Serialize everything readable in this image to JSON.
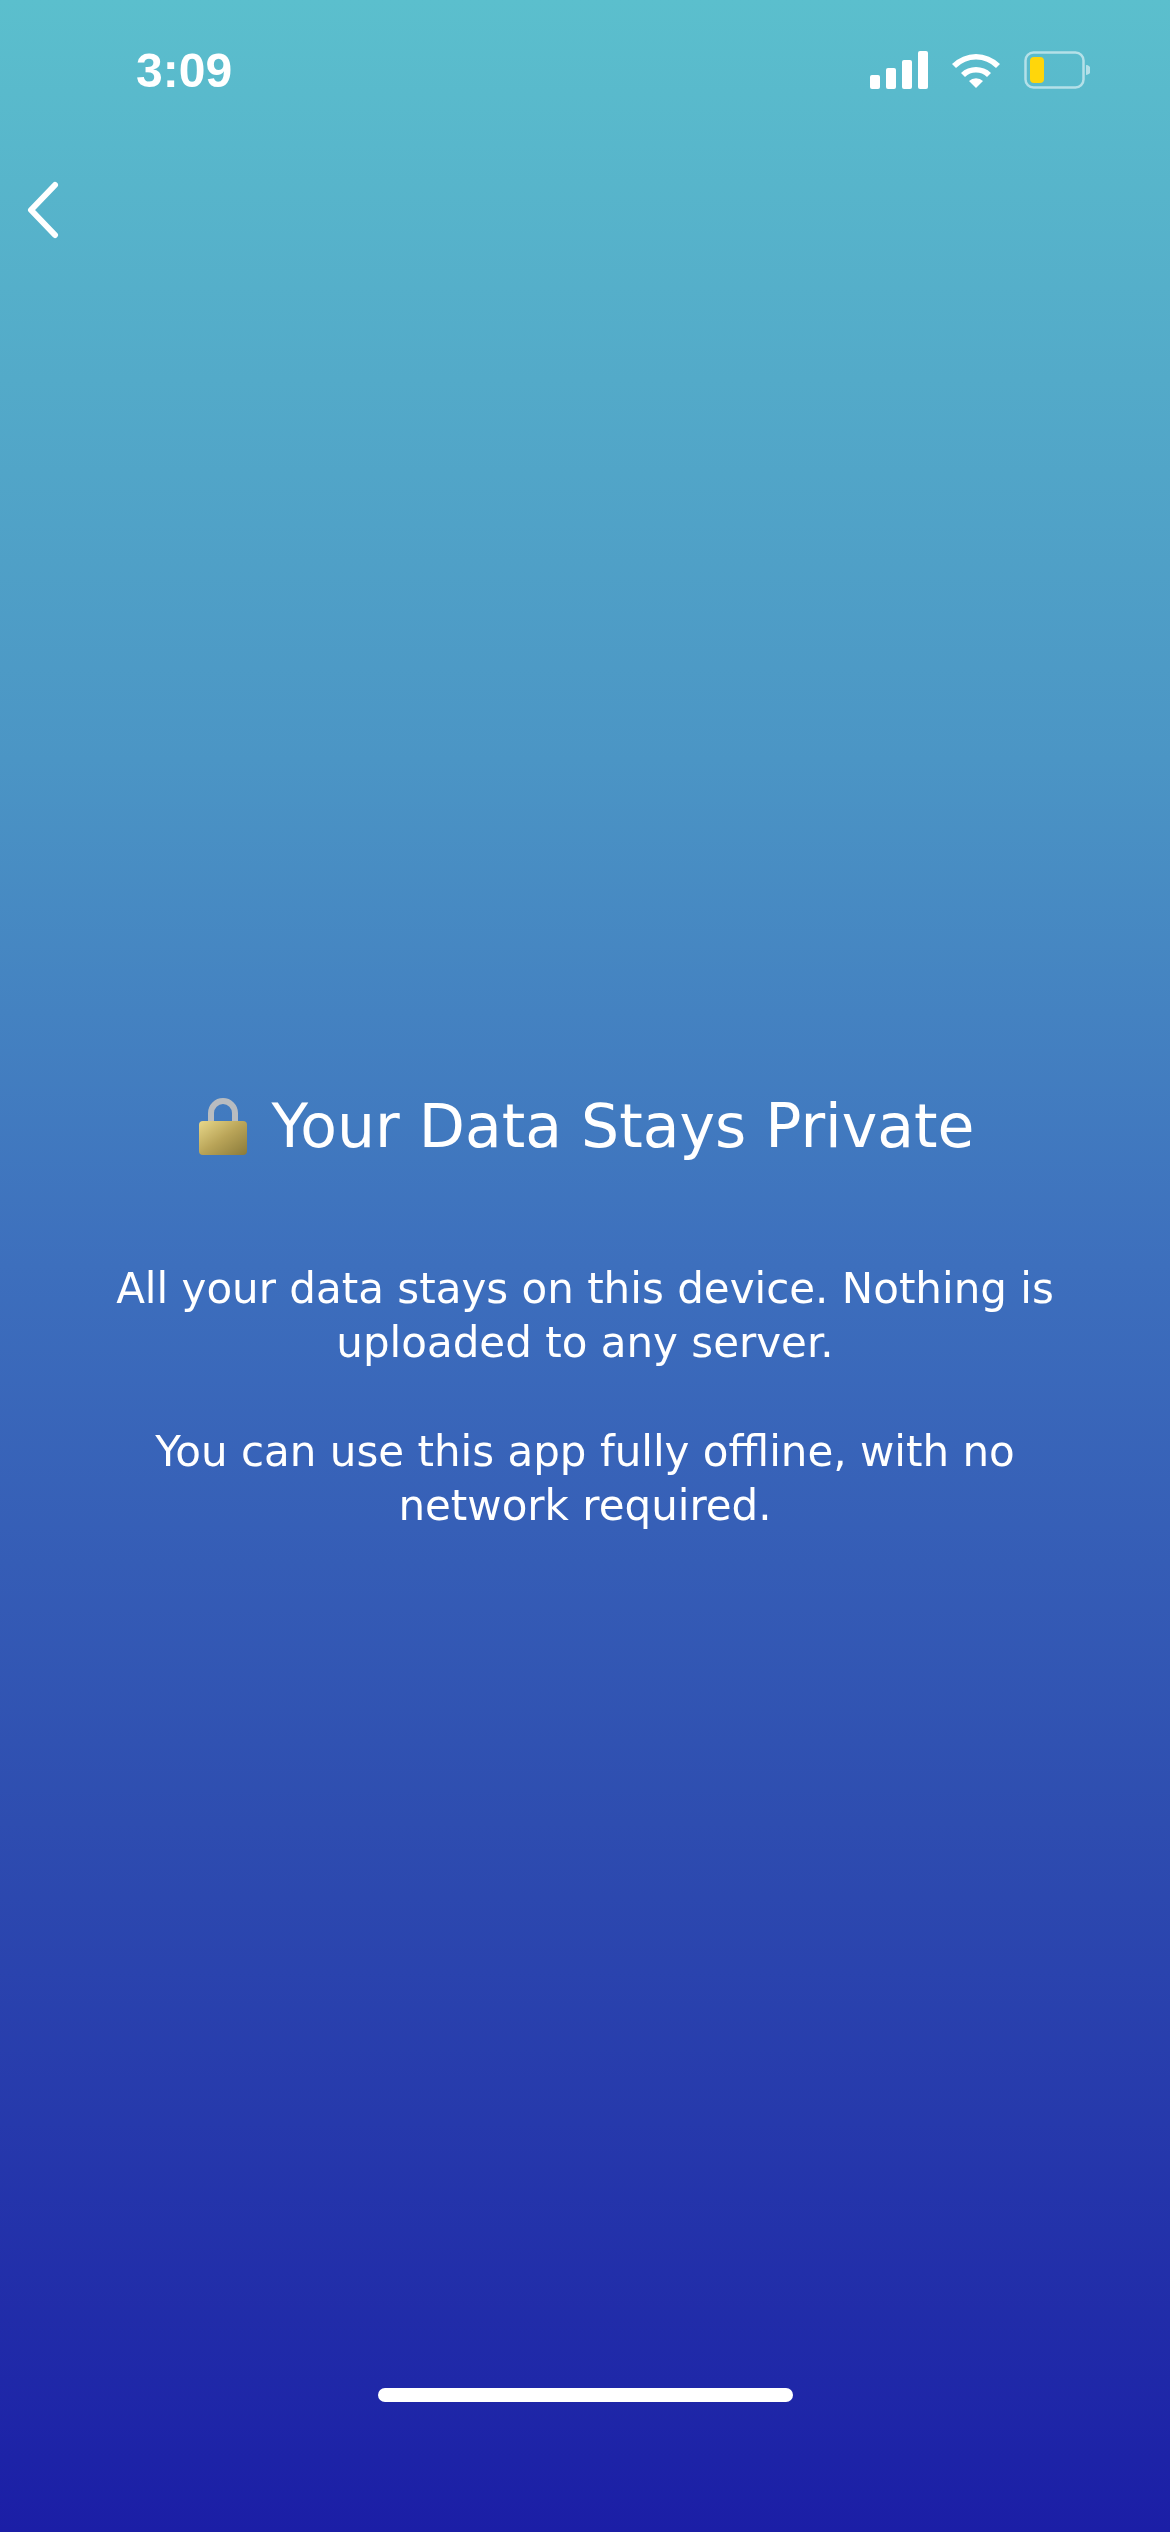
{
  "status_bar": {
    "time": "3:09"
  },
  "title": "Your Data Stays Private",
  "paragraphs": [
    "All your data stays on this device. Nothing is uploaded to any server.",
    "You can use this app fully offline, with no network required."
  ]
}
